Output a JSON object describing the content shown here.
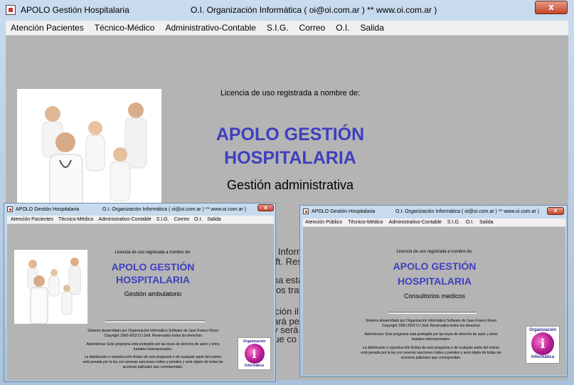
{
  "main": {
    "title": "APOLO Gestión Hospitalaria",
    "title_right": "O.I.  Organización  Informática  ( oi@oi.com.ar )  **  www.oi.com.ar )",
    "menu": [
      "Atención Pacientes",
      "Técnico-Médico",
      "Administrativo-Contable",
      "S.I.G.",
      "Correo",
      "O.I.",
      "Salida"
    ],
    "license": "Licencia de uso registrada a nombre de:",
    "app_line1": "APOLO GESTIÓN",
    "app_line2": "HOSPITALARIA",
    "subtitle": "Gestión administrativa",
    "partial_1": "n Inform",
    "partial_2": "oft. Res",
    "partial_3": "ma está",
    "partial_4": "tros trat",
    "partial_5": "cción ilíc",
    "partial_6": "ará pe",
    "partial_7": "y será",
    "partial_8": "que co"
  },
  "win_left": {
    "title": "APOLO Gestión Hospitalaria",
    "title_right": "O.I.   Organización  Informática  ( oi@oi.com.ar )  **  www.oi.com.ar )",
    "menu": [
      "Atención Pacientes",
      "Técnico-Médico",
      "Administrativo-Contable",
      "S.I.G.",
      "Correo",
      "O.I.",
      "Salida"
    ],
    "license": "Licencia de uso registrada a nombre de:",
    "app_line1": "APOLO GESTIÓN",
    "app_line2": "HOSPITALARIA",
    "subtitle": "Gestión ambulatorio",
    "dev_1": "Sistema desarrollado por Organización Informática Software de Juan Franco Rossi",
    "dev_2": "Copyright 1990-2002 O.I.Soft. Reservados todos los derechos",
    "warn_1": "Advertencia: Este programa está protegido por las leyes de derecho de autor y otros",
    "warn_2": "tratados internacionales.",
    "legal_1": "La distribución o reproducción ilícitas de este programa o de cualquier parte del mismo",
    "legal_2": "está penada por la ley con severas sanciones civiles y penales y será objeto de todas las",
    "legal_3": "acciones judiciales que correspondan."
  },
  "win_right": {
    "title": "APOLO Gestión Hospitalaria",
    "title_right": "O.I.   Organización  Informática  ( oi@oi.com.ar )  **  www.oi.com.ar )",
    "menu": [
      "Atención Público",
      "Técnico-Médico",
      "Administrativo-Contable",
      "S.I.G.",
      "O.I.",
      "Salida"
    ],
    "license": "Licencia de uso registrada a nombre de:",
    "app_line1": "APOLO GESTIÓN",
    "app_line2": "HOSPITALARIA",
    "subtitle": "Consultorios medicos",
    "dev_1": "Sistema desarrollado por Organización Informática Software de Juan Franco Rossi",
    "dev_2": "Copyright 1990-2002 O.I.Soft. Reservados todos los derechos",
    "warn_1": "Advertencia: Este programa está protegido por las leyes de derecho de autor y otros",
    "warn_2": "tratados internacionales.",
    "legal_1": "La distribución o reproducción ilícitas de este programa o de cualquier parte del mismo",
    "legal_2": "está penada por la ley con severas sanciones civiles y penales y será objeto de todas las",
    "legal_3": "acciones judiciales que correspondan."
  },
  "logo": {
    "top": "Organización",
    "bottom": "Informática"
  },
  "close_glyph": "x"
}
